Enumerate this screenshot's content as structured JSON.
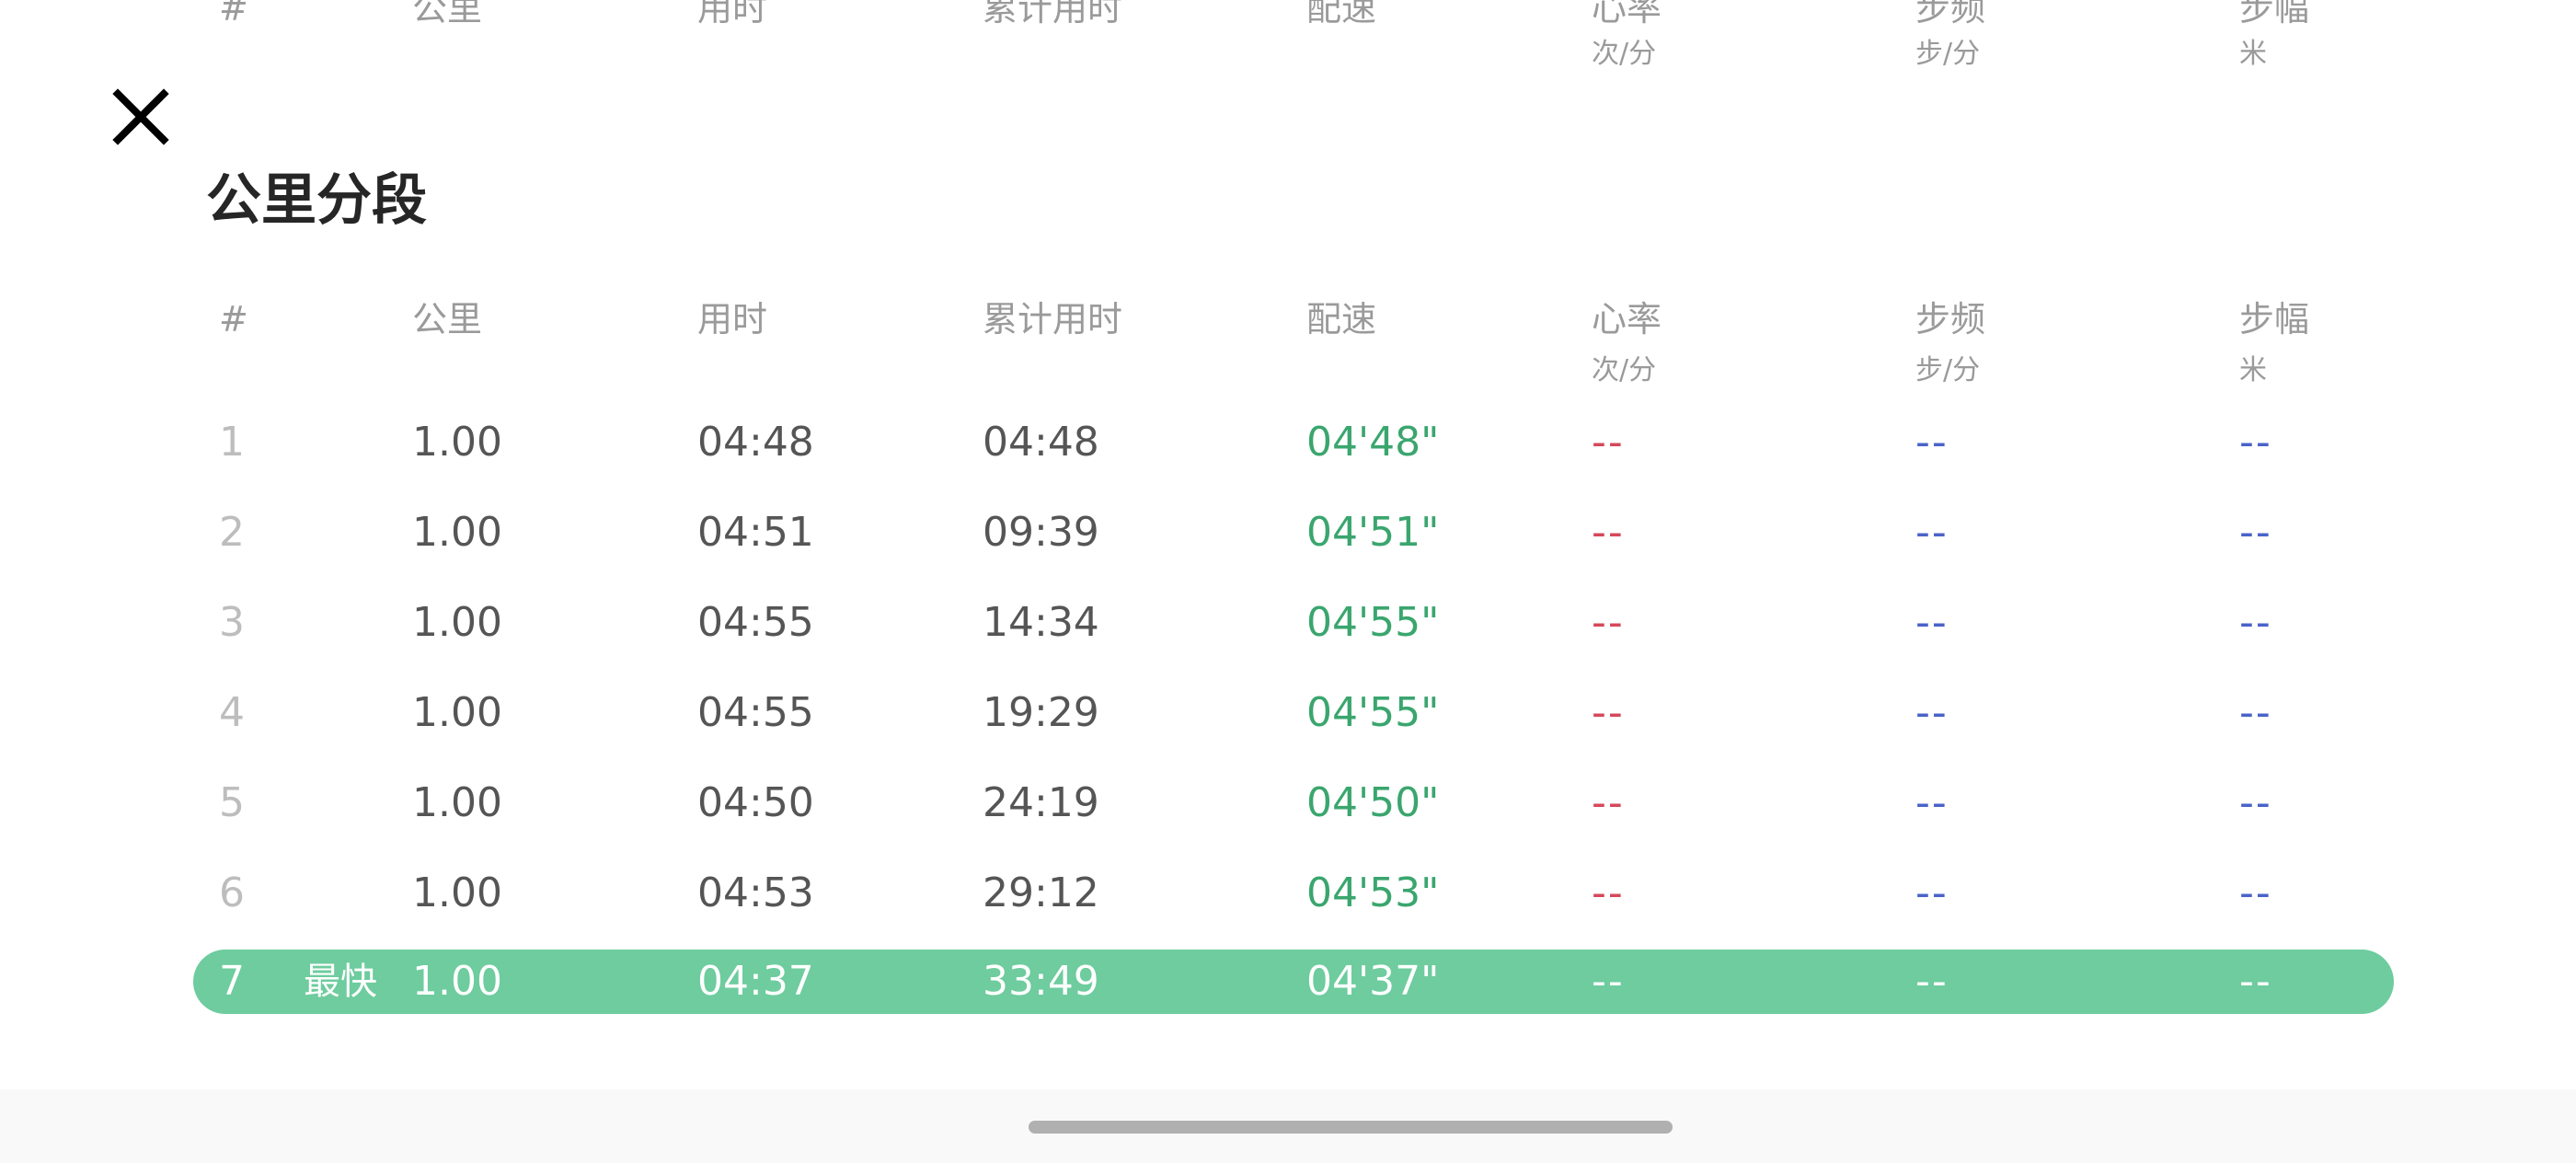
{
  "sheet": {
    "title": "公里分段"
  },
  "columns": {
    "index": "#",
    "km": "公里",
    "time": "用时",
    "cumulative": "累计用时",
    "pace": "配速",
    "heart_rate": "心率",
    "heart_rate_unit": "次/分",
    "cadence": "步频",
    "cadence_unit": "步/分",
    "stride": "步幅",
    "stride_unit": "米"
  },
  "splits": [
    {
      "index": "1",
      "km": "1.00",
      "time": "04:48",
      "cumulative": "04:48",
      "pace": "04'48\"",
      "heart_rate": "--",
      "cadence": "--",
      "stride": "--"
    },
    {
      "index": "2",
      "km": "1.00",
      "time": "04:51",
      "cumulative": "09:39",
      "pace": "04'51\"",
      "heart_rate": "--",
      "cadence": "--",
      "stride": "--"
    },
    {
      "index": "3",
      "km": "1.00",
      "time": "04:55",
      "cumulative": "14:34",
      "pace": "04'55\"",
      "heart_rate": "--",
      "cadence": "--",
      "stride": "--"
    },
    {
      "index": "4",
      "km": "1.00",
      "time": "04:55",
      "cumulative": "19:29",
      "pace": "04'55\"",
      "heart_rate": "--",
      "cadence": "--",
      "stride": "--"
    },
    {
      "index": "5",
      "km": "1.00",
      "time": "04:50",
      "cumulative": "24:19",
      "pace": "04'50\"",
      "heart_rate": "--",
      "cadence": "--",
      "stride": "--"
    },
    {
      "index": "6",
      "km": "1.00",
      "time": "04:53",
      "cumulative": "29:12",
      "pace": "04'53\"",
      "heart_rate": "--",
      "cadence": "--",
      "stride": "--"
    },
    {
      "index": "7",
      "badge": "最快",
      "km": "1.00",
      "time": "04:37",
      "cumulative": "33:49",
      "pace": "04'37\"",
      "heart_rate": "--",
      "cadence": "--",
      "stride": "--"
    }
  ],
  "colors": {
    "pace_green": "#3aa66e",
    "highlight_green": "#6ecc9e",
    "heart_rate_red": "#d6485a",
    "metric_blue": "#4a63c9"
  },
  "icons": {
    "close": "close-icon"
  }
}
